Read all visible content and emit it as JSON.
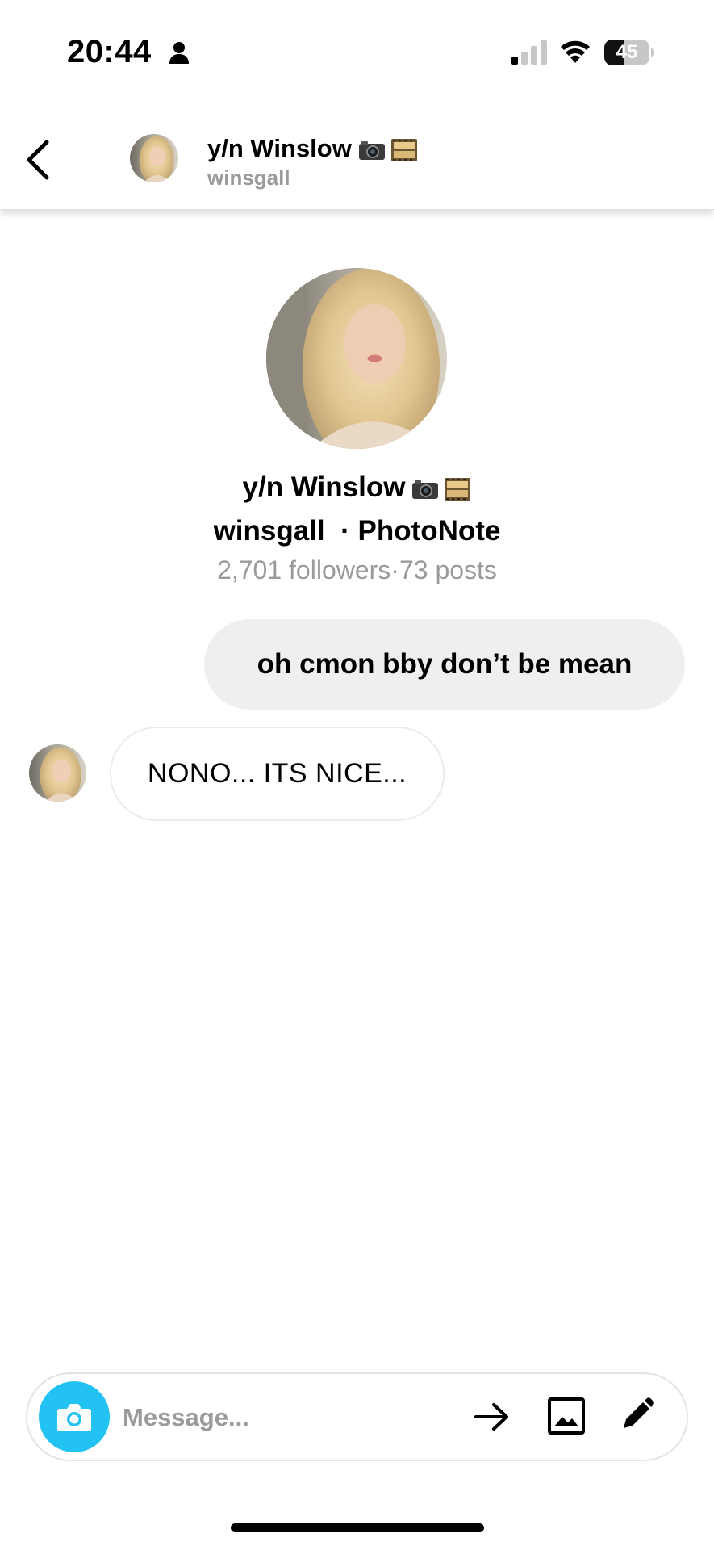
{
  "status_bar": {
    "time": "20:44",
    "battery_percent": "45",
    "battery_level": 0.45,
    "signal_bars_active": 1,
    "icons": [
      "person-icon",
      "signal-icon",
      "wifi-icon",
      "battery-icon"
    ]
  },
  "header": {
    "display_name": "y/n Winslow",
    "username": "winsgall",
    "icons": [
      "back-chevron-icon",
      "camera-emoji-icon",
      "film-frames-emoji-icon"
    ]
  },
  "profile": {
    "display_name": "y/n Winslow",
    "username": "winsgall",
    "separator": "·",
    "app_name": "PhotoNote",
    "followers": "2,701 followers",
    "stats_separator": "·",
    "posts": "73 posts"
  },
  "messages": [
    {
      "direction": "outgoing",
      "text": "oh cmon bby don’t be mean"
    },
    {
      "direction": "incoming",
      "text": "NONO... ITS NICE..."
    }
  ],
  "composer": {
    "placeholder": "Message...",
    "icons": [
      "camera-icon",
      "send-arrow-icon",
      "gallery-icon",
      "pen-icon"
    ]
  },
  "colors": {
    "accent_camera": "#22c3f3",
    "bubble_outgoing": "#efefef",
    "muted_text": "#9a9a9a"
  }
}
